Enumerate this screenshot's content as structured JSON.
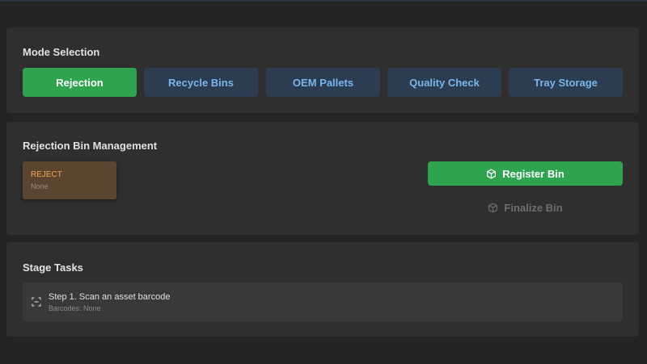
{
  "mode_selection": {
    "title": "Mode Selection",
    "modes": [
      {
        "label": "Rejection",
        "active": true
      },
      {
        "label": "Recycle Bins",
        "active": false
      },
      {
        "label": "OEM Pallets",
        "active": false
      },
      {
        "label": "Quality Check",
        "active": false
      },
      {
        "label": "Tray Storage",
        "active": false
      }
    ]
  },
  "bin_management": {
    "title": "Rejection Bin Management",
    "bin": {
      "label": "REJECT",
      "value": "None"
    },
    "register_label": "Register Bin",
    "finalize_label": "Finalize Bin"
  },
  "stage_tasks": {
    "title": "Stage Tasks",
    "tasks": [
      {
        "title": "Step 1. Scan an asset barcode",
        "subtitle": "Barcodes: None"
      }
    ]
  },
  "icons": {
    "register": "box-icon",
    "finalize": "box-icon",
    "task": "scan-icon"
  },
  "colors": {
    "accent_green": "#2ea44f",
    "mode_inactive_bg": "#2c3d52",
    "mode_inactive_text": "#79b6ec",
    "bin_bg": "#5b4430",
    "bin_label": "#f0a850"
  }
}
